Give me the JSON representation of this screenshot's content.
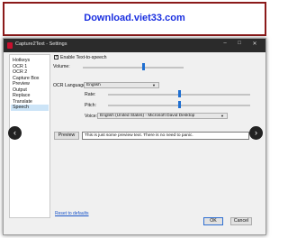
{
  "banner": {
    "text": "Download.viet33.com"
  },
  "window": {
    "title": "Capture2Text - Settings",
    "controls": {
      "minimize": "–",
      "maximize": "□",
      "close": "✕"
    }
  },
  "sidebar": {
    "items": [
      {
        "label": "Hotkeys"
      },
      {
        "label": "OCR 1"
      },
      {
        "label": "OCR 2"
      },
      {
        "label": "Capture Box"
      },
      {
        "label": "Preview"
      },
      {
        "label": "Output"
      },
      {
        "label": "Replace"
      },
      {
        "label": "Translate"
      },
      {
        "label": "Speech"
      }
    ],
    "selected": "Speech"
  },
  "speech": {
    "enable_label": "Enable Text-to-speech",
    "enable_checked": true,
    "volume_label": "Volume:",
    "volume_level": 0.6,
    "ocr_language_label": "OCR Language:",
    "ocr_language_value": "English",
    "rate_label": "Rate:",
    "rate_level": 0.5,
    "pitch_label": "Pitch:",
    "pitch_level": 0.5,
    "voice_label": "Voice:",
    "voice_value": "English (United States) - Microsoft David Desktop",
    "preview_button": "Preview",
    "preview_text": "This is just some preview text. There is no need to panic."
  },
  "footer": {
    "reset_link": "Reset to defaults",
    "ok_button": "OK",
    "cancel_button": "Cancel"
  },
  "nav": {
    "prev": "‹",
    "next": "›"
  },
  "colors": {
    "accent": "#1f6fd1",
    "banner_border": "#8b1a1a",
    "banner_text": "#1a2fe0",
    "titlebar": "#2b2b2b"
  }
}
